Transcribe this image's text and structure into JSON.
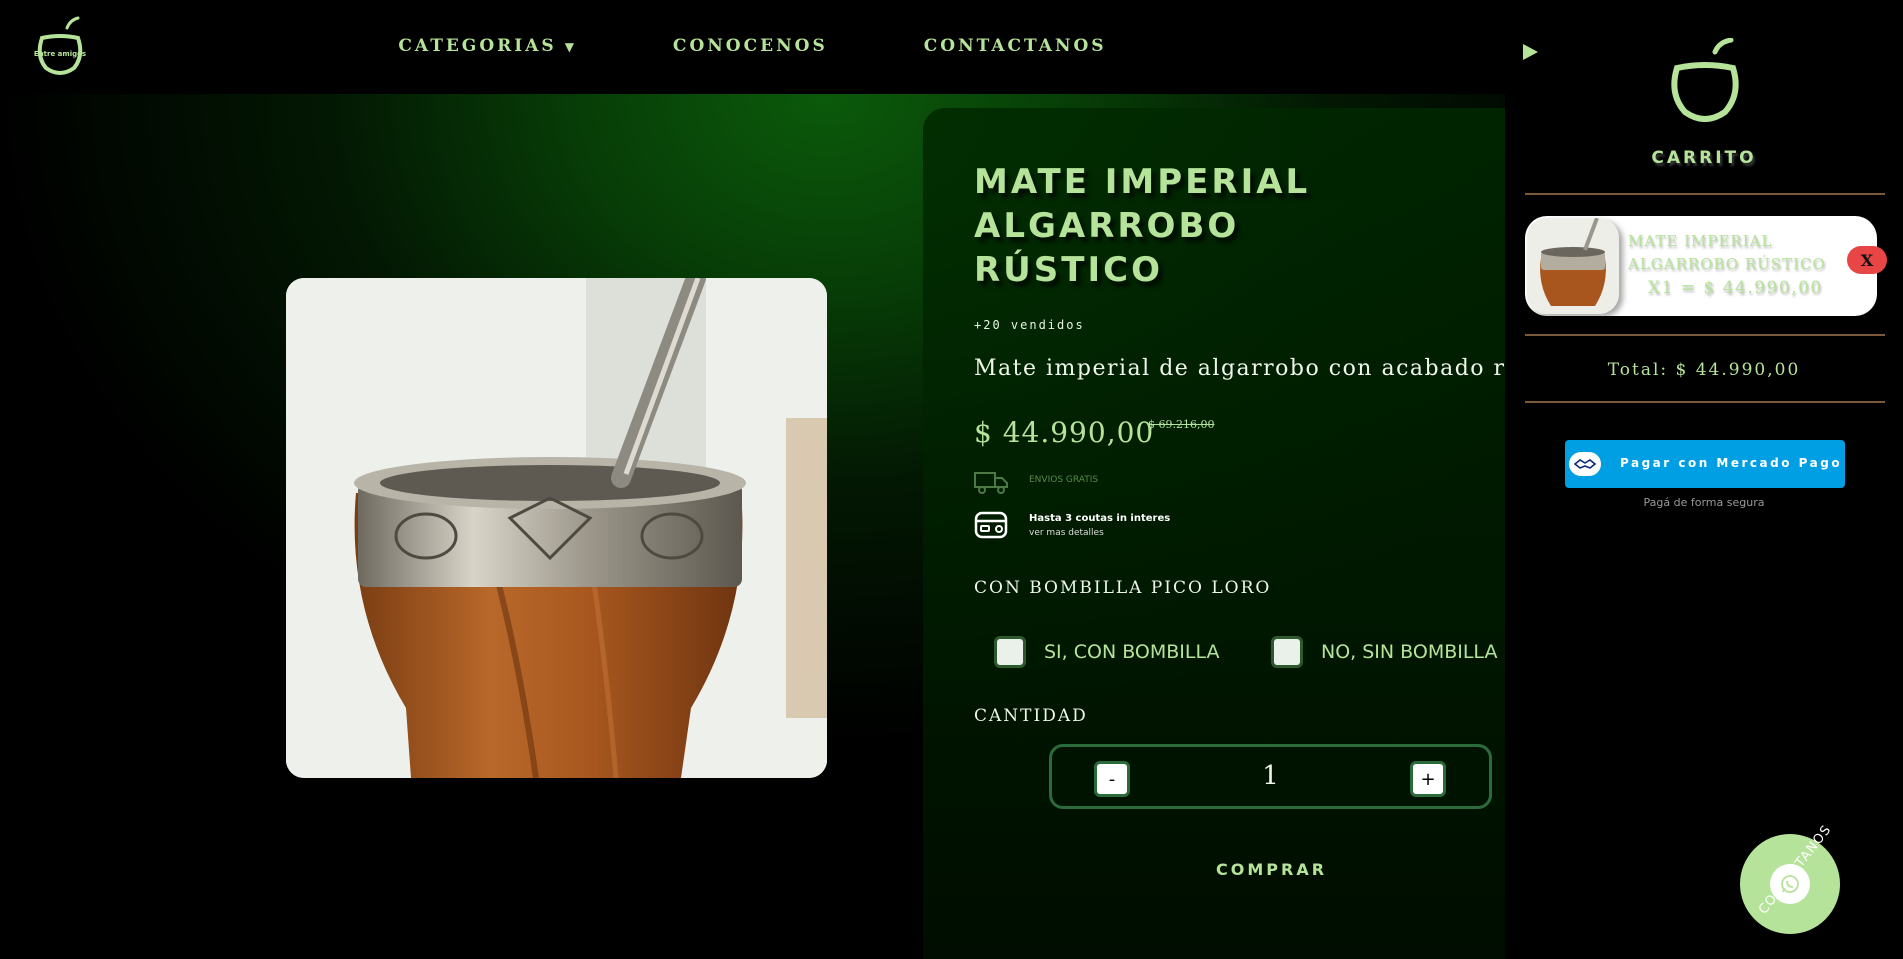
{
  "header": {
    "logo_text": "Entre amigos",
    "nav": [
      {
        "label": "CATEGORIAS",
        "caret": "▼"
      },
      {
        "label": "CONOCENOS"
      },
      {
        "label": "CONTACTANOS"
      }
    ]
  },
  "product": {
    "title": "MATE IMPERIAL ALGARROBO RÚSTICO",
    "sold": "+20 vendidos",
    "description": "Mate imperial de algarrobo con acabado rústico",
    "price": "$ 44.990,00",
    "old_price": "$ 69.216,00",
    "shipping": "ENVIOS GRATIS",
    "installments_title": "Hasta 3 coutas in interes",
    "installments_link": "ver mas detalles",
    "bombilla_label": "CON BOMBILLA PICO LORO",
    "options": [
      "SI, CON BOMBILLA",
      "NO, SIN BOMBILLA"
    ],
    "quantity_label": "CANTIDAD",
    "quantity": "1",
    "minus": "-",
    "plus": "+",
    "buy": "COMPRAR"
  },
  "cart": {
    "title": "CARRITO",
    "item": {
      "name": "MATE IMPERIAL ALGARROBO RÚSTICO",
      "qty_price": "X1 = $ 44.990,00",
      "remove": "X"
    },
    "total": "Total: $ 44.990,00",
    "pay_button": "Pagar con Mercado Pago",
    "secure": "Pagá de forma segura"
  },
  "fab": {
    "label": "CONTACTANOS"
  },
  "colors": {
    "accent": "#b6e39a",
    "background": "#000000",
    "green_glow": "#0b5a0b",
    "remove": "#e84545",
    "mercadopago": "#009ee3"
  }
}
